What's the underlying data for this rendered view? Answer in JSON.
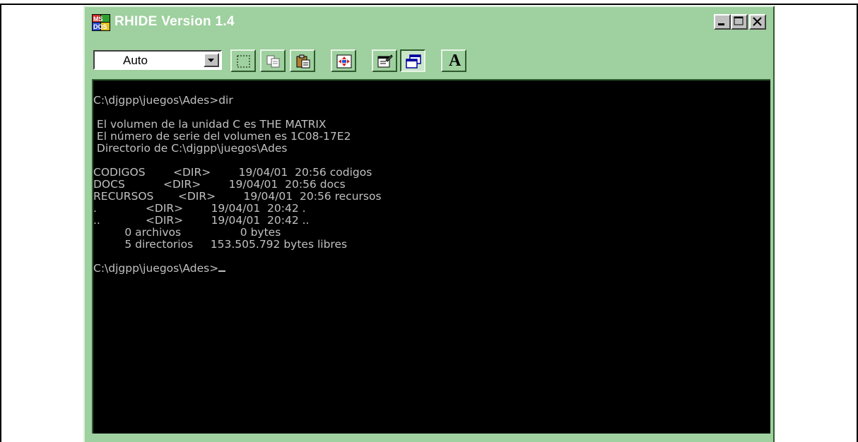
{
  "window": {
    "title": "RHIDE Version 1.4",
    "icon": "ms-dos-icon",
    "controls": [
      "minimize",
      "maximize",
      "close"
    ]
  },
  "toolbar": {
    "font_size_select": {
      "value": "Auto"
    },
    "buttons": [
      {
        "name": "mark-button",
        "icon": "dotted-rectangle-icon"
      },
      {
        "name": "copy-button",
        "icon": "copy-icon"
      },
      {
        "name": "paste-button",
        "icon": "clipboard-icon"
      },
      {
        "name": "fullscreen-button",
        "icon": "fullscreen-arrows-icon"
      },
      {
        "name": "properties-button",
        "icon": "properties-icon"
      },
      {
        "name": "background-button",
        "icon": "window-icon",
        "pressed": true
      },
      {
        "name": "font-button",
        "icon": "font-a-icon",
        "label": "A"
      }
    ]
  },
  "console": {
    "lines": [
      "C:\\djgpp\\juegos\\Ades>dir",
      "",
      " El volumen de la unidad C es THE MATRIX",
      " El número de serie del volumen es 1C08-17E2",
      " Directorio de C:\\djgpp\\juegos\\Ades",
      "",
      "CODIGOS        <DIR>        19/04/01  20:56 codigos",
      "DOCS           <DIR>        19/04/01  20:56 docs",
      "RECURSOS       <DIR>        19/04/01  20:56 recursos",
      ".              <DIR>        19/04/01  20:42 .",
      "..             <DIR>        19/04/01  20:42 ..",
      "         0 archivos                 0 bytes",
      "         5 directorios     153.505.792 bytes libres",
      ""
    ],
    "prompt": "C:\\djgpp\\juegos\\Ades>"
  },
  "colors": {
    "window_face": "#9fd09f",
    "console_bg": "#000000",
    "console_text": "#c0c0c0",
    "title_text": "#ffffff"
  }
}
